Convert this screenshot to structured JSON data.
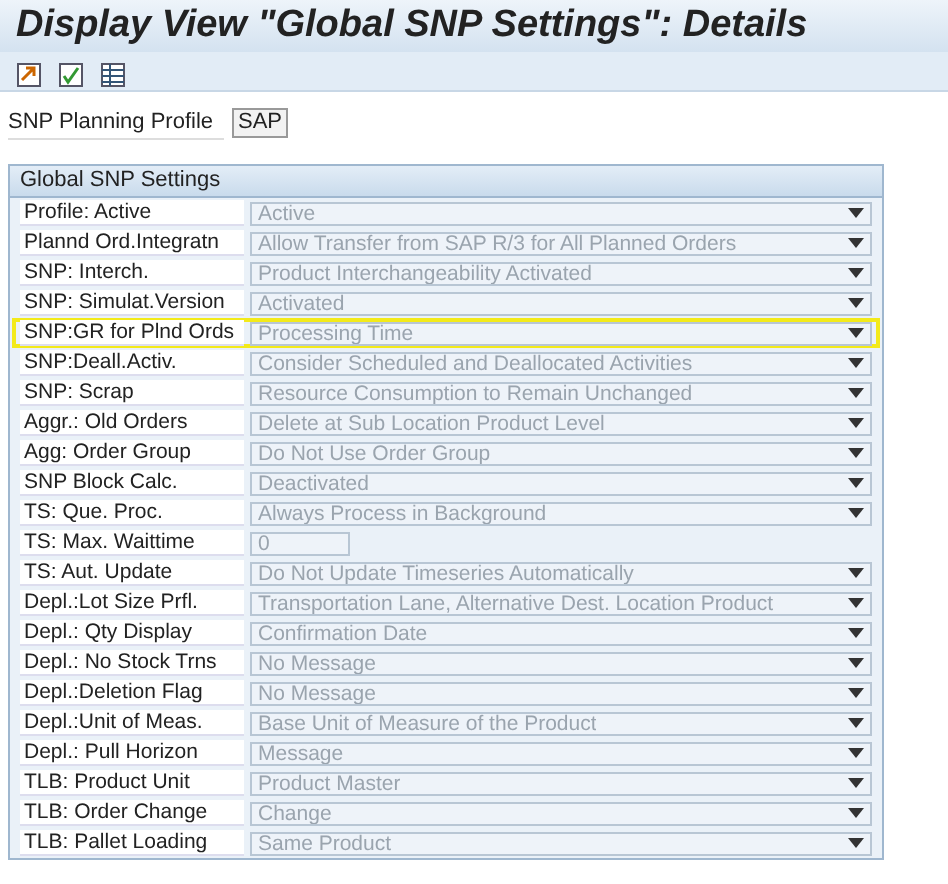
{
  "window": {
    "title": "Display View \"Global SNP Settings\": Details"
  },
  "toolbar": {
    "buttons": [
      {
        "kind": "doc-arrow"
      },
      {
        "kind": "doc-check"
      },
      {
        "kind": "doc-table"
      }
    ]
  },
  "profile": {
    "label": "SNP Planning Profile",
    "value": "SAP"
  },
  "group": {
    "title": "Global SNP Settings",
    "rows": [
      {
        "label": "Profile: Active",
        "value": "Active",
        "kind": "dropdown",
        "highlighted": false,
        "disabled": true
      },
      {
        "label": "Plannd Ord.Integratn",
        "value": "Allow Transfer from SAP R/3 for All Planned Orders",
        "kind": "dropdown",
        "highlighted": false,
        "disabled": true
      },
      {
        "label": "SNP: Interch.",
        "value": "Product Interchangeability Activated",
        "kind": "dropdown",
        "highlighted": false,
        "disabled": true
      },
      {
        "label": "SNP: Simulat.Version",
        "value": "Activated",
        "kind": "dropdown",
        "highlighted": false,
        "disabled": true
      },
      {
        "label": "SNP:GR for Plnd Ords",
        "value": "Processing Time",
        "kind": "dropdown",
        "highlighted": true,
        "disabled": true
      },
      {
        "label": "SNP:Deall.Activ.",
        "value": "Consider Scheduled and Deallocated Activities",
        "kind": "dropdown",
        "highlighted": false,
        "disabled": true
      },
      {
        "label": "SNP: Scrap",
        "value": "Resource Consumption to Remain Unchanged",
        "kind": "dropdown",
        "highlighted": false,
        "disabled": true
      },
      {
        "label": "Aggr.: Old Orders",
        "value": "Delete at Sub Location Product Level",
        "kind": "dropdown",
        "highlighted": false,
        "disabled": true
      },
      {
        "label": "Agg: Order Group",
        "value": "Do Not Use Order Group",
        "kind": "dropdown",
        "highlighted": false,
        "disabled": true
      },
      {
        "label": "SNP Block Calc.",
        "value": "Deactivated",
        "kind": "dropdown",
        "highlighted": false,
        "disabled": true
      },
      {
        "label": "TS: Que. Proc.",
        "value": "Always Process in Background",
        "kind": "dropdown",
        "highlighted": false,
        "disabled": true
      },
      {
        "label": "TS: Max. Waittime",
        "value": "0",
        "kind": "input",
        "highlighted": false,
        "disabled": true
      },
      {
        "label": "TS: Aut. Update",
        "value": "Do Not Update Timeseries Automatically",
        "kind": "dropdown",
        "highlighted": false,
        "disabled": true
      },
      {
        "label": "Depl.:Lot Size Prfl.",
        "value": "Transportation Lane, Alternative Dest. Location Product",
        "kind": "dropdown",
        "highlighted": false,
        "disabled": true
      },
      {
        "label": "Depl.: Qty Display",
        "value": "Confirmation Date",
        "kind": "dropdown",
        "highlighted": false,
        "disabled": true
      },
      {
        "label": "Depl.: No Stock Trns",
        "value": "No Message",
        "kind": "dropdown",
        "highlighted": false,
        "disabled": true
      },
      {
        "label": "Depl.:Deletion Flag",
        "value": "No Message",
        "kind": "dropdown",
        "highlighted": false,
        "disabled": true
      },
      {
        "label": "Depl.:Unit of Meas.",
        "value": "Base Unit of Measure of the Product",
        "kind": "dropdown",
        "highlighted": false,
        "disabled": true
      },
      {
        "label": "Depl.: Pull Horizon",
        "value": "Message",
        "kind": "dropdown",
        "highlighted": false,
        "disabled": true
      },
      {
        "label": "TLB: Product Unit",
        "value": "Product Master",
        "kind": "dropdown",
        "highlighted": false,
        "disabled": true
      },
      {
        "label": "TLB: Order Change",
        "value": "Change",
        "kind": "dropdown",
        "highlighted": false,
        "disabled": true
      },
      {
        "label": "TLB: Pallet Loading",
        "value": "Same Product",
        "kind": "dropdown",
        "highlighted": false,
        "disabled": true
      }
    ]
  }
}
